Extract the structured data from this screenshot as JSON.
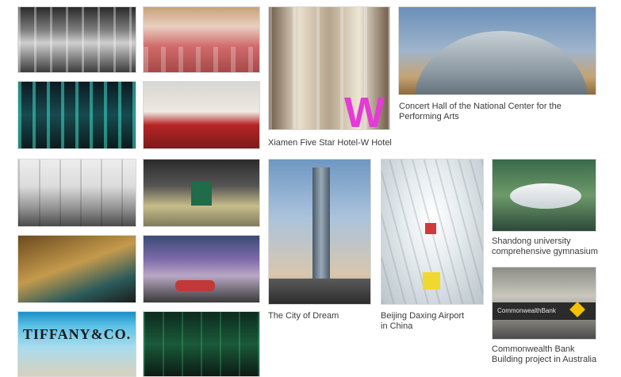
{
  "gallery": {
    "projects": [
      {
        "caption_line1": "Concert Hall of the National Center for the",
        "caption_line2": "Performing Arts"
      },
      {
        "caption_line1": "Xiamen Five Star Hotel-W Hotel"
      },
      {
        "caption_line1": "The City of Dream"
      },
      {
        "caption_line1": "Beijing Daxing Airport",
        "caption_line2": "in China"
      },
      {
        "caption_line1": "Shandong university",
        "caption_line2": "comprehensive gymnasium"
      },
      {
        "caption_line1": "Commonwealth Bank",
        "caption_line2": "Building project in Australia"
      }
    ],
    "photo_text": {
      "tiffany_sign": "TIFFANY&CO.",
      "w_logo": "W",
      "commonwealth_sign": "CommonwealthBank"
    }
  }
}
